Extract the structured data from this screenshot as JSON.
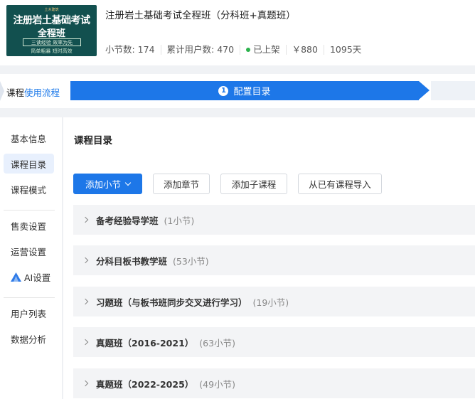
{
  "course": {
    "title": "注册岩土基础考试全程班（分科班+真题班）",
    "cover": {
      "top_text": "土木建筑",
      "title_line1": "注册岩土基础考试",
      "title_line2": "全程班",
      "slogan1": "三读经验  效率为先",
      "slogan2": "简单粗暴  短时高效"
    },
    "stats": {
      "lessons": "小节数: 174",
      "users": "累计用户数: 470",
      "status": "已上架",
      "price": "￥880",
      "duration": "1095天"
    },
    "status_color": "#2bb24c"
  },
  "flow": {
    "label_prefix": "课程",
    "label_link": "使用流程",
    "current_step_number": "1",
    "current_step_label": "配置目录"
  },
  "sidebar": {
    "items": [
      {
        "label": "基本信息"
      },
      {
        "label": "课程目录",
        "active": true
      },
      {
        "label": "课程模式"
      },
      {
        "label": "售卖设置"
      },
      {
        "label": "运营设置"
      },
      {
        "label": "AI设置",
        "icon": "ai-icon"
      },
      {
        "label": "用户列表"
      },
      {
        "label": "数据分析"
      }
    ]
  },
  "main": {
    "title": "课程目录",
    "buttons": {
      "add_section": "添加小节",
      "add_chapter": "添加章节",
      "add_subcourse": "添加子课程",
      "import_existing": "从已有课程导入"
    },
    "chapters": [
      {
        "title": "备考经验导学班",
        "count": "(1小节)"
      },
      {
        "title": "分科目板书教学班",
        "count": "(53小节)"
      },
      {
        "title": "习题班（与板书班同步交叉进行学习）",
        "count": "(19小节)"
      },
      {
        "title": "真题班（2016-2021）",
        "count": "(63小节)"
      },
      {
        "title": "真题班（2022-2025）",
        "count": "(49小节)"
      }
    ]
  },
  "colors": {
    "accent": "#1d77e8",
    "active_nav_bg": "#e8f0fd",
    "chapter_bg": "#f3f4f6"
  }
}
